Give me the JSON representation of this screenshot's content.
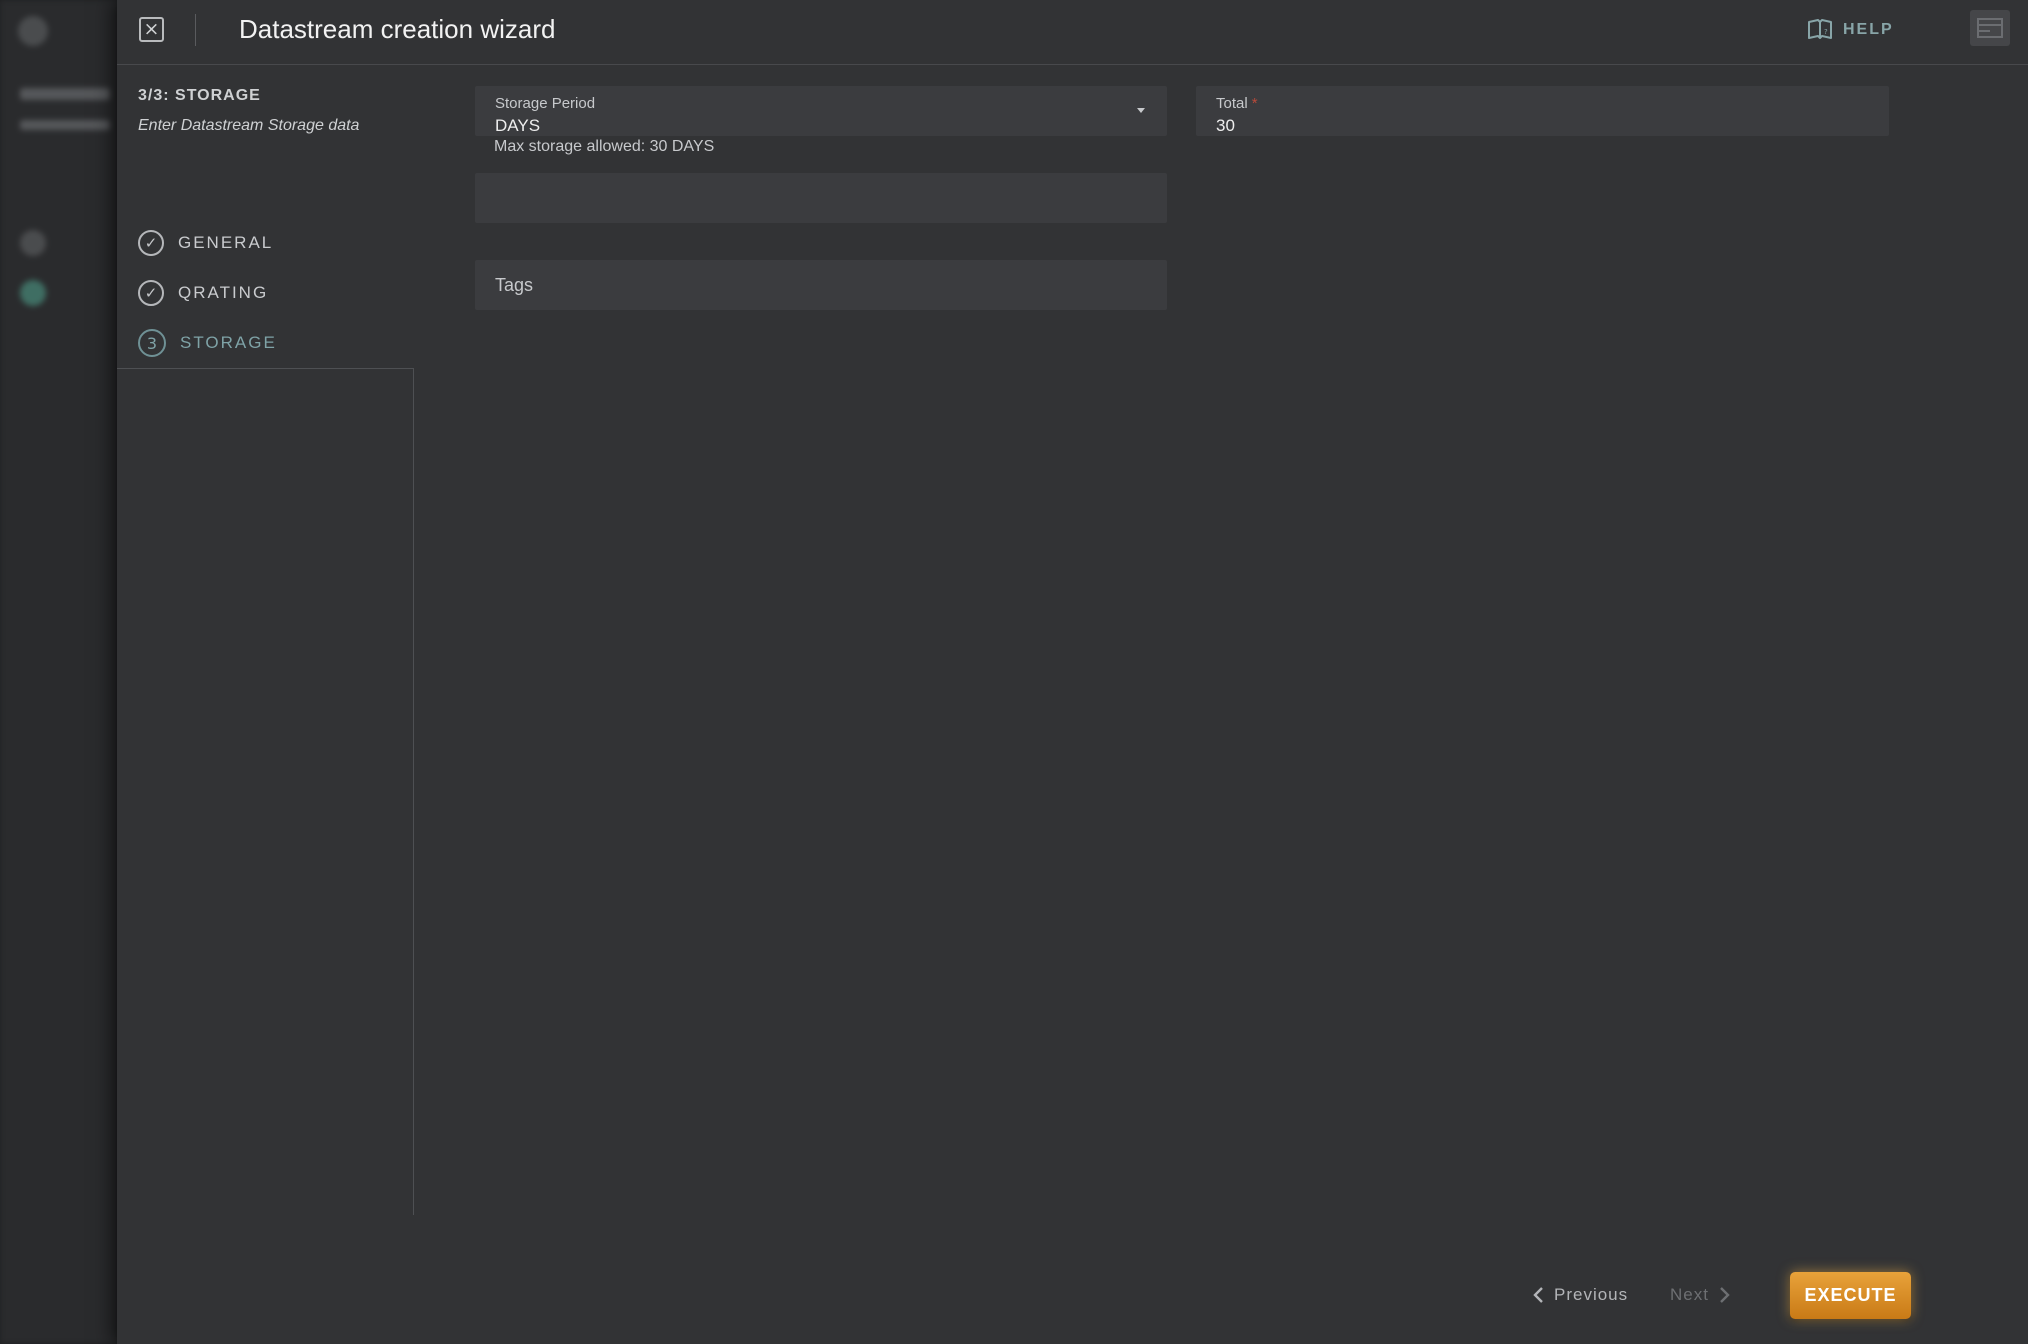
{
  "header": {
    "title": "Datastream creation wizard",
    "help_label": "HELP"
  },
  "steps": {
    "heading": "3/3: STORAGE",
    "subtitle": "Enter Datastream Storage data",
    "items": [
      {
        "label": "GENERAL",
        "state": "done"
      },
      {
        "label": "QRATING",
        "state": "done"
      },
      {
        "label": "STORAGE",
        "state": "active",
        "number": "3"
      }
    ]
  },
  "form": {
    "storage_period": {
      "label": "Storage Period",
      "value": "DAYS"
    },
    "total": {
      "label": "Total",
      "required_mark": "*",
      "value": "30"
    },
    "hint": "Max storage allowed: 30 DAYS",
    "tags": {
      "placeholder": "Tags"
    }
  },
  "footer": {
    "previous_label": "Previous",
    "next_label": "Next",
    "execute_label": "EXECUTE"
  },
  "colors": {
    "panel": "#323335",
    "field": "#3b3c3f",
    "accent_teal": "#7fa3a7",
    "execute": "#e0952c"
  }
}
